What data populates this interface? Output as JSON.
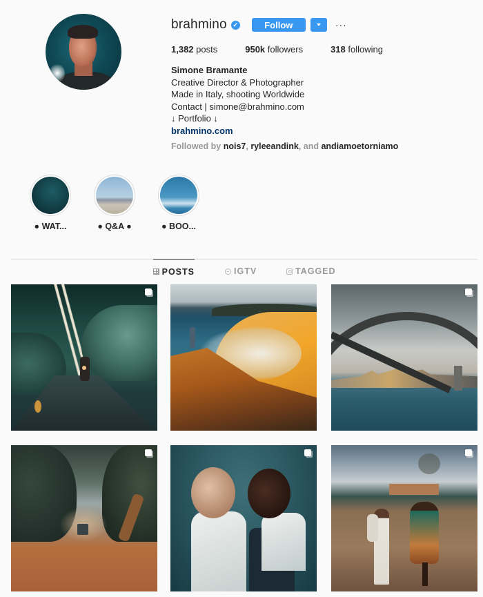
{
  "profile": {
    "username": "brahmino",
    "verified": true,
    "verified_icon": "✓",
    "follow_label": "Follow",
    "more_label": "···",
    "stats": [
      {
        "value": "1,382",
        "label": " posts"
      },
      {
        "value": "950k",
        "label": " followers"
      },
      {
        "value": "318",
        "label": " following"
      }
    ],
    "bio": {
      "name": "Simone Bramante",
      "lines": [
        "Creative Director & Photographer",
        "Made in Italy, shooting Worldwide",
        "Contact | simone@brahmino.com",
        "↓ Portfolio ↓"
      ],
      "link": "brahmino.com"
    },
    "followed_by": {
      "prefix": "Followed by ",
      "users": [
        "nois7",
        "ryleeandink",
        "andiamoetorniamo"
      ],
      "sep1": ", ",
      "sep2": ", and "
    }
  },
  "highlights": [
    {
      "label": "● WAT..."
    },
    {
      "label": "● Q&A ●"
    },
    {
      "label": "● BOO..."
    }
  ],
  "tabs": [
    {
      "label": "POSTS",
      "icon": "grid-icon",
      "active": true
    },
    {
      "label": "IGTV",
      "icon": "igtv-icon",
      "active": false
    },
    {
      "label": "TAGGED",
      "icon": "tagged-icon",
      "active": false
    }
  ],
  "posts": [
    {
      "subject": "motorcycle on forest road",
      "multi": true
    },
    {
      "subject": "person on cliff above beach",
      "multi": false
    },
    {
      "subject": "harbour bridge over water",
      "multi": true
    },
    {
      "subject": "jeep on dusty savanna road",
      "multi": true
    },
    {
      "subject": "two schoolboys facing each other",
      "multi": true
    },
    {
      "subject": "children carrying babies in village",
      "multi": true
    }
  ],
  "colors": {
    "accent": "#3897f0",
    "text": "#262626",
    "muted": "#999999",
    "link": "#003569",
    "background": "#fafafa"
  }
}
